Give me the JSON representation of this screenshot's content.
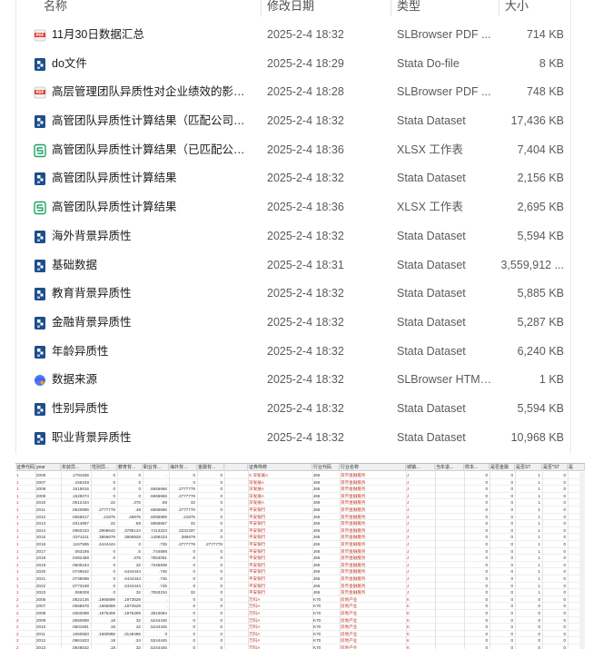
{
  "columns": {
    "name": "名称",
    "date": "修改日期",
    "type": "类型",
    "size": "大小"
  },
  "files": [
    {
      "icon": "pdf-icon",
      "name": "11月30日数据汇总",
      "date": "2025-2-4 18:32",
      "type": "SLBrowser PDF ...",
      "size": "714 KB"
    },
    {
      "icon": "stata-icon",
      "name": "do文件",
      "date": "2025-2-4 18:29",
      "type": "Stata Do-file",
      "size": "8 KB"
    },
    {
      "icon": "pdf-icon",
      "name": "高层管理团队异质性对企业绩效的影响研...",
      "date": "2025-2-4 18:28",
      "type": "SLBrowser PDF ...",
      "size": "748 KB"
    },
    {
      "icon": "stata-icon",
      "name": "高管团队异质性计算结果（匹配公司基本...",
      "date": "2025-2-4 18:32",
      "type": "Stata Dataset",
      "size": "17,436 KB"
    },
    {
      "icon": "xlsx-icon",
      "name": "高管团队异质性计算结果（已匹配公司基...",
      "date": "2025-2-4 18:36",
      "type": "XLSX 工作表",
      "size": "7,404 KB"
    },
    {
      "icon": "stata-icon",
      "name": "高管团队异质性计算结果",
      "date": "2025-2-4 18:32",
      "type": "Stata Dataset",
      "size": "2,156 KB"
    },
    {
      "icon": "xlsx-icon",
      "name": "高管团队异质性计算结果",
      "date": "2025-2-4 18:36",
      "type": "XLSX 工作表",
      "size": "2,695 KB"
    },
    {
      "icon": "stata-icon",
      "name": "海外背景异质性",
      "date": "2025-2-4 18:32",
      "type": "Stata Dataset",
      "size": "5,594 KB"
    },
    {
      "icon": "stata-icon",
      "name": "基础数据",
      "date": "2025-2-4 18:31",
      "type": "Stata Dataset",
      "size": "3,559,912 ..."
    },
    {
      "icon": "stata-icon",
      "name": "教育背景异质性",
      "date": "2025-2-4 18:32",
      "type": "Stata Dataset",
      "size": "5,885 KB"
    },
    {
      "icon": "stata-icon",
      "name": "金融背景异质性",
      "date": "2025-2-4 18:32",
      "type": "Stata Dataset",
      "size": "5,287 KB"
    },
    {
      "icon": "stata-icon",
      "name": "年龄异质性",
      "date": "2025-2-4 18:32",
      "type": "Stata Dataset",
      "size": "6,240 KB"
    },
    {
      "icon": "html-icon",
      "name": "数据来源",
      "date": "2025-2-4 18:32",
      "type": "SLBrowser HTML...",
      "size": "1 KB"
    },
    {
      "icon": "stata-icon",
      "name": "性别异质性",
      "date": "2025-2-4 18:32",
      "type": "Stata Dataset",
      "size": "5,594 KB"
    },
    {
      "icon": "stata-icon",
      "name": "职业背景异质性",
      "date": "2025-2-4 18:32",
      "type": "Stata Dataset",
      "size": "10,968 KB"
    }
  ],
  "sheet": {
    "headers": [
      "证券代码",
      "year",
      "年龄异...",
      "性别异...",
      "教育背...",
      "职业背...",
      "海外背...",
      "金融背...",
      "",
      "证券简称",
      "行业代码",
      "行业名称",
      "城镇...",
      "当年退...",
      "样本...",
      "是否金融",
      "是否ST",
      "是否*ST",
      "是"
    ],
    "rows": [
      [
        "1",
        "2006",
        ".1791836",
        "0",
        "0",
        ".",
        "0",
        "0",
        "",
        "S 深发展A",
        "J66",
        "货币金融服务",
        "J",
        "",
        "0",
        "0",
        "1",
        "0",
        ""
      ],
      [
        "1",
        "2007",
        ".155248",
        "0",
        "0",
        ".",
        "0",
        "0",
        "",
        "深发展A",
        "J66",
        "货币金融服务",
        "J",
        "",
        "0",
        "0",
        "1",
        "0",
        ""
      ],
      [
        "1",
        "2008",
        ".1615616",
        "0",
        "0",
        ".6666666",
        ".2777778",
        "0",
        "",
        "深发展A",
        "J66",
        "货币金融服务",
        "J",
        "",
        "0",
        "0",
        "1",
        "0",
        ""
      ],
      [
        "1",
        "2009",
        ".1528074",
        "0",
        "0",
        ".6666666",
        ".2777778",
        "0",
        "",
        "深发展A",
        "J66",
        "货币金融服务",
        "J",
        "",
        "0",
        "0",
        "1",
        "0",
        ""
      ],
      [
        "1",
        "2010",
        ".0512434",
        ".32",
        ".375",
        ".56",
        "33",
        "0",
        "",
        "深发展A",
        "J66",
        "货币金融服务",
        "J",
        "",
        "0",
        "0",
        "1",
        "0",
        ""
      ],
      [
        "1",
        "2011",
        ".0520896",
        ".2777778",
        ".48",
        ".6666666",
        ".2777778",
        "0",
        "",
        "平安银行",
        "J66",
        "货币金融服务",
        "J",
        "",
        "0",
        "0",
        "1",
        "0",
        ""
      ],
      [
        "1",
        "2012",
        ".0655617",
        ".21875",
        ".46875",
        ".6085899",
        ".21875",
        "0",
        "",
        "平安银行",
        "J66",
        "货币金融服务",
        "J",
        "",
        "0",
        "0",
        "1",
        "0",
        ""
      ],
      [
        "1",
        "2013",
        ".0314687",
        ".32",
        ".56",
        ".6666667",
        "32",
        "0",
        "",
        "平安银行",
        "J66",
        "货币金融服务",
        "J",
        "",
        "0",
        "0",
        "1",
        "0",
        ""
      ],
      [
        "1",
        "2014",
        ".0960233",
        ".2968642",
        ".3785124",
        ".7413223",
        ".2231337",
        "0",
        "",
        "平安银行",
        "J66",
        "货币金融服务",
        "J",
        "",
        "0",
        "0",
        "1",
        "0",
        ""
      ],
      [
        "1",
        "2015",
        ".0374211",
        ".3856679",
        ".3858828",
        ".1488223",
        ".385679",
        "0",
        "",
        "平安银行",
        "J66",
        "货币金融服务",
        "J",
        "",
        "0",
        "0",
        "1",
        "0",
        ""
      ],
      [
        "1",
        "2016",
        ".1167595",
        ".4444444",
        "0",
        ".735",
        ".2777778",
        ".2777778",
        "",
        "平安银行",
        "J66",
        "货币金融服务",
        "J",
        "",
        "0",
        "0",
        "1",
        "0",
        ""
      ],
      [
        "1",
        "2017",
        ".063186",
        "0",
        ".5",
        ".744898",
        "0",
        "0",
        "",
        "平安银行",
        "J66",
        "货币金融服务",
        "J",
        "",
        "0",
        "0",
        "1",
        "0",
        ""
      ],
      [
        "1",
        "2018",
        ".0492459",
        "0",
        ".375",
        ".7653061",
        "0",
        "0",
        "",
        "平安银行",
        "J66",
        "货币金融服务",
        "J",
        "",
        "0",
        "0",
        "1",
        "0",
        ""
      ],
      [
        "1",
        "2019",
        ".0605154",
        "0",
        "32",
        ".7346938",
        "0",
        "0",
        "",
        "平安银行",
        "J66",
        "货币金融服务",
        "J",
        "",
        "0",
        "0",
        "1",
        "0",
        ""
      ],
      [
        "1",
        "2020",
        ".0746542",
        "0",
        ".4444444",
        ".745",
        "0",
        "0",
        "",
        "平安银行",
        "J66",
        "货币金融服务",
        "J",
        "",
        "0",
        "0",
        "1",
        "0",
        ""
      ],
      [
        "1",
        "2021",
        ".0738098",
        "0",
        ".4444444",
        ".745",
        "0",
        "0",
        "",
        "平安银行",
        "J66",
        "货币金融服务",
        "J",
        "",
        "0",
        "0",
        "1",
        "0",
        ""
      ],
      [
        "1",
        "2022",
        ".0773158",
        "0",
        ".4444444",
        ".745",
        "0",
        "0",
        "",
        "平安银行",
        "J66",
        "货币金融服务",
        "J",
        "",
        "0",
        "0",
        "1",
        "0",
        ""
      ],
      [
        "1",
        "2023",
        ".066008",
        "0",
        "32",
        ".7063234",
        "32",
        "0",
        "",
        "平安银行",
        "J66",
        "货币金融服务",
        "J",
        "",
        "0",
        "0",
        "1",
        "0",
        ""
      ],
      [
        "2",
        "2006",
        ".0822136",
        ".1965899",
        ".1973528",
        ".",
        "0",
        "0",
        "",
        "万科A",
        "K70",
        "房地产业",
        "K",
        "",
        "0",
        "0",
        "0",
        "0",
        ""
      ],
      [
        "2",
        "2007",
        ".0568978",
        ".1965899",
        ".1973528",
        ".",
        "0",
        "0",
        "",
        "万科A",
        "K70",
        "房地产业",
        "K",
        "",
        "0",
        "0",
        "0",
        "0",
        ""
      ],
      [
        "2",
        "2008",
        ".0363098",
        ".1975309",
        ".1975309",
        ".3510084",
        "0",
        "0",
        "",
        "万科A",
        "K70",
        "房地产业",
        "K",
        "",
        "0",
        "0",
        "0",
        "0",
        ""
      ],
      [
        "2",
        "2009",
        ".0560698",
        ".18",
        "32",
        ".5244445",
        "0",
        "0",
        "",
        "万科A",
        "K70",
        "房地产业",
        "K",
        "",
        "0",
        "0",
        "0",
        "0",
        ""
      ],
      [
        "2",
        "2010",
        ".0601591",
        ".18",
        "32",
        ".5244445",
        "0",
        "0",
        "",
        "万科A",
        "K70",
        "房地产业",
        "K",
        "",
        "0",
        "0",
        "0",
        "0",
        ""
      ],
      [
        "2",
        "2011",
        ".1060583",
        ".1660988",
        ".3149496",
        "0",
        "0",
        "0",
        "",
        "万科A",
        "K70",
        "房地产业",
        "K",
        "",
        "0",
        "0",
        "0",
        "0",
        ""
      ],
      [
        "2",
        "2012",
        ".0961823",
        ".18",
        ".34",
        ".5244445",
        "0",
        "0",
        "",
        "万科A",
        "K70",
        "房地产业",
        "K",
        "",
        "0",
        "0",
        "0",
        "0",
        ""
      ],
      [
        "2",
        "2013",
        ".0846532",
        ".18",
        "32",
        ".5244445",
        "0",
        "0",
        "",
        "万科A",
        "K70",
        "房地产业",
        "K",
        "",
        "0",
        "0",
        "0",
        "0",
        ""
      ]
    ]
  }
}
